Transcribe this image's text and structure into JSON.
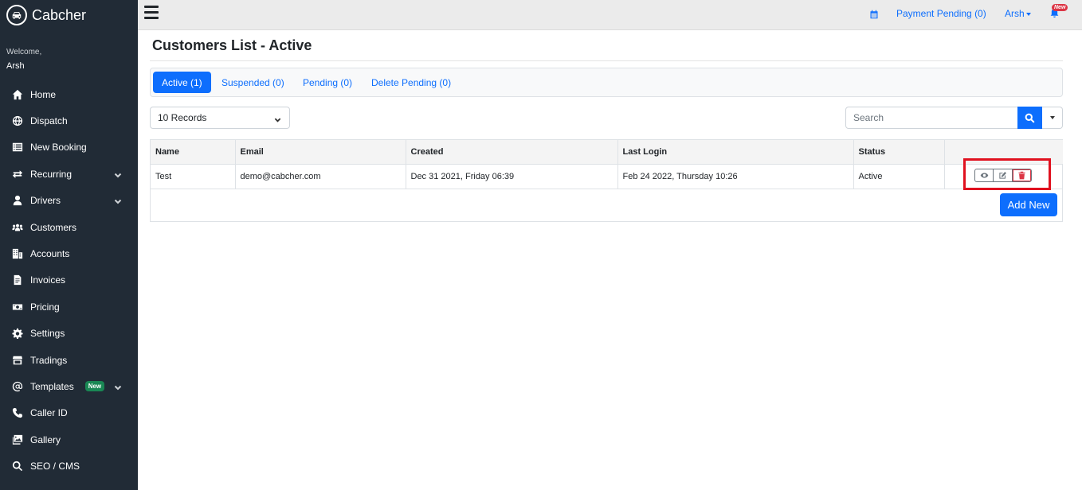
{
  "brand": {
    "name": "Cabcher",
    "icon": "car-icon"
  },
  "sidebar": {
    "welcome": "Welcome,",
    "user": "Arsh",
    "items": [
      {
        "label": "Home",
        "icon": "home-icon"
      },
      {
        "label": "Dispatch",
        "icon": "globe-icon"
      },
      {
        "label": "New Booking",
        "icon": "list-icon"
      },
      {
        "label": "Recurring",
        "icon": "repeat-icon",
        "chevron": true
      },
      {
        "label": "Drivers",
        "icon": "user-icon",
        "chevron": true
      },
      {
        "label": "Customers",
        "icon": "users-icon"
      },
      {
        "label": "Accounts",
        "icon": "building-icon"
      },
      {
        "label": "Invoices",
        "icon": "file-icon"
      },
      {
        "label": "Pricing",
        "icon": "money-icon"
      },
      {
        "label": "Settings",
        "icon": "gear-icon"
      },
      {
        "label": "Tradings",
        "icon": "store-icon"
      },
      {
        "label": "Templates",
        "icon": "at-icon",
        "badge": "New",
        "chevron": true
      },
      {
        "label": "Caller ID",
        "icon": "phone-icon"
      },
      {
        "label": "Gallery",
        "icon": "images-icon"
      },
      {
        "label": "SEO / CMS",
        "icon": "seo-search-icon"
      }
    ]
  },
  "topbar": {
    "payment": "Payment Pending (0)",
    "user": "Arsh",
    "new_badge": "New"
  },
  "page": {
    "title": "Customers List - Active",
    "tabs": [
      {
        "label": "Active (1)",
        "active": true
      },
      {
        "label": "Suspended (0)",
        "active": false
      },
      {
        "label": "Pending (0)",
        "active": false
      },
      {
        "label": "Delete Pending (0)",
        "active": false
      }
    ],
    "records": "10 Records",
    "search_placeholder": "Search",
    "add_new": "Add New"
  },
  "table": {
    "headers": [
      "Name",
      "Email",
      "Created",
      "Last Login",
      "Status",
      ""
    ],
    "rows": [
      [
        "Test",
        "demo@cabcher.com",
        "Dec 31 2021, Friday 06:39",
        "Feb 24 2022, Thursday 10:26",
        "Active"
      ]
    ]
  },
  "colors": {
    "sidebar": "#212b36",
    "primary": "#0d6efd",
    "danger": "#dc3545",
    "highlight": "#e0111f"
  }
}
